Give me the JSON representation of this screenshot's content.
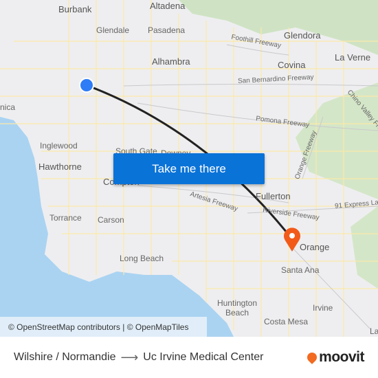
{
  "map": {
    "places": [
      "Burbank",
      "Altadena",
      "Glendale",
      "Pasadena",
      "Glendora",
      "Alhambra",
      "Covina",
      "La Verne",
      "nica",
      "Inglewood",
      "Hawthorne",
      "South Gate",
      "Downey",
      "Compton",
      "Torrance",
      "Carson",
      "Fullerton",
      "Orange",
      "Santa Ana",
      "Long Beach",
      "Huntington Beach",
      "Costa Mesa",
      "Irvine",
      "La"
    ],
    "freeways": [
      "Foothill Freeway",
      "San Bernardino Freeway",
      "Pomona Freeway",
      "Chino Valley Fre",
      "Orange Freeway",
      "Artesia Freeway",
      "Riverside Freeway",
      "91 Express Lan"
    ],
    "origin_marker_color": "#2e7cf6",
    "destination_marker_color": "#f25a1a",
    "route_color": "#222222"
  },
  "cta": {
    "label": "Take me there"
  },
  "attribution": "© OpenStreetMap contributors | © OpenMapTiles",
  "footer": {
    "origin": "Wilshire / Normandie",
    "arrow": "⟶",
    "destination": "Uc Irvine Medical Center",
    "brand": "moovit"
  }
}
